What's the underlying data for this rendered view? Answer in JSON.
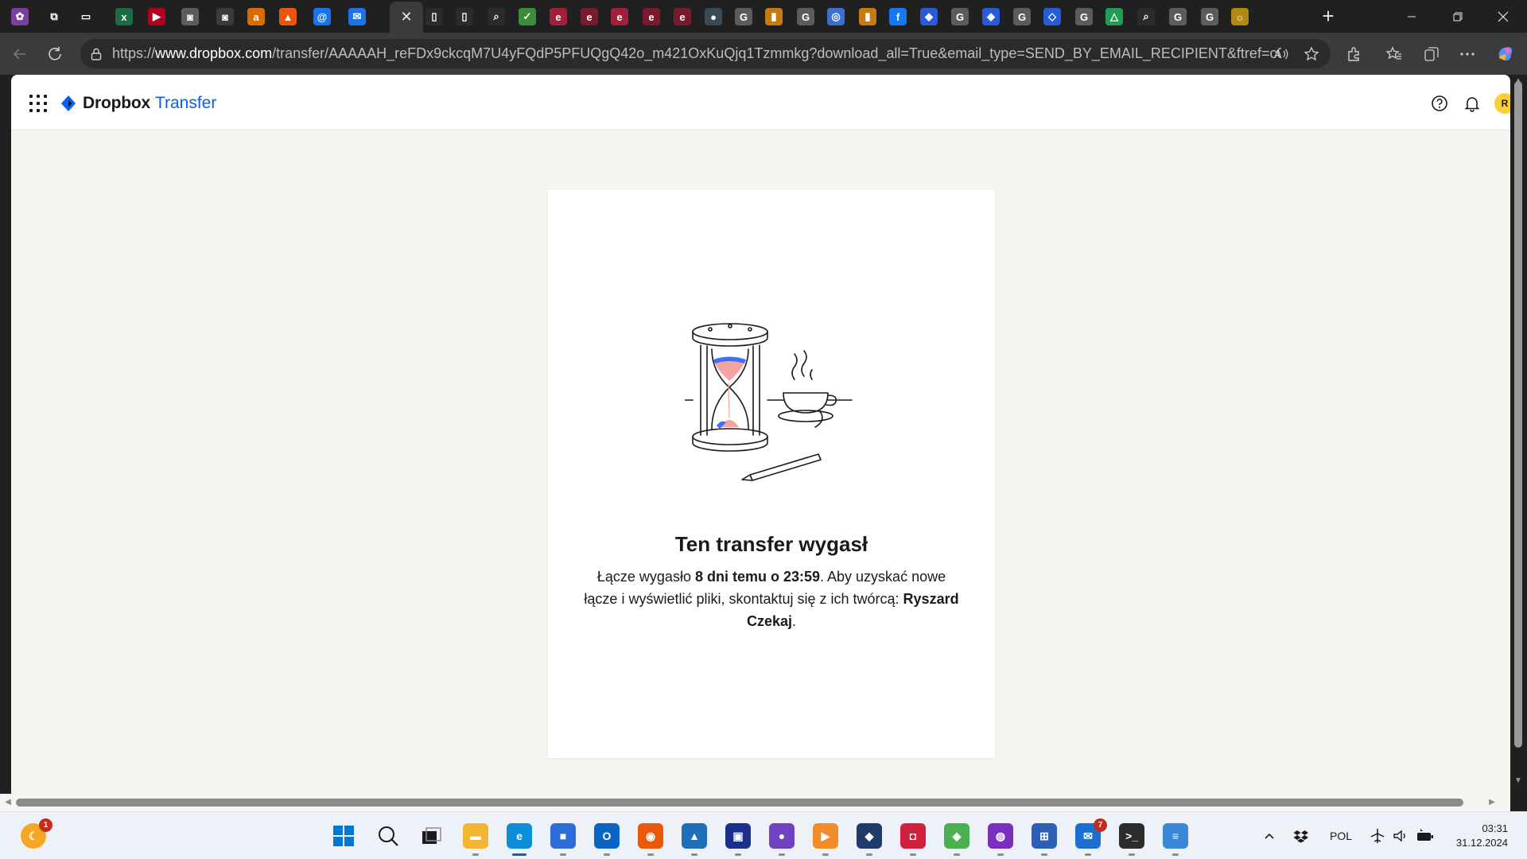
{
  "browser": {
    "url_prefix": "https://",
    "url_host": "www.dropbox.com",
    "url_path": "/transfer/AAAAAH_reFDx9ckcqM7U4yFQdP5PFUQgQ42o_m421OxKuQjq1Tzmmkg?download_all=True&email_type=SEND_BY_EMAIL_RECIPIENT&ftref=c0ee4fd...",
    "active_tab_close": "✕",
    "new_tab": "+",
    "tabs": [
      {
        "icon": "photo-app-icon",
        "glyph": "✿",
        "color": "#7a3fa0"
      },
      {
        "icon": "workspaces-icon",
        "glyph": "⧉",
        "color": "#202020"
      },
      {
        "icon": "tab-actions-icon",
        "glyph": "▭",
        "color": "#202020"
      },
      {
        "icon": "site-icon-x",
        "glyph": "x",
        "color": "#1d6b43"
      },
      {
        "icon": "youtube-icon",
        "glyph": "▶",
        "color": "#b00020"
      },
      {
        "icon": "camera-icon",
        "glyph": "◙",
        "color": "#5c5c5c"
      },
      {
        "icon": "camera-icon",
        "glyph": "◙",
        "color": "#3a3a3a"
      },
      {
        "icon": "amazon-icon",
        "glyph": "a",
        "color": "#d96b00"
      },
      {
        "icon": "allegro-icon",
        "glyph": "▲",
        "color": "#e8570d"
      },
      {
        "icon": "at-mail-icon",
        "glyph": "@",
        "color": "#1a73e8"
      },
      {
        "icon": "mail-icon",
        "glyph": "✉",
        "color": "#1a73e8"
      },
      {
        "icon": "document-icon",
        "glyph": "▯",
        "color": "#2b2b2b"
      },
      {
        "icon": "document-icon",
        "glyph": "▯",
        "color": "#2b2b2b"
      },
      {
        "icon": "search-icon",
        "glyph": "⌕",
        "color": "#2b2b2b"
      },
      {
        "icon": "check-icon",
        "glyph": "✓",
        "color": "#3b8c3b"
      },
      {
        "icon": "site-icon-e",
        "glyph": "e",
        "color": "#a0203a"
      },
      {
        "icon": "site-icon-e",
        "glyph": "e",
        "color": "#7a1a2c"
      },
      {
        "icon": "site-icon-e",
        "glyph": "e",
        "color": "#a0203a"
      },
      {
        "icon": "site-icon-e",
        "glyph": "e",
        "color": "#7a1a2c"
      },
      {
        "icon": "site-icon-e",
        "glyph": "e",
        "color": "#7a1a2c"
      },
      {
        "icon": "profile-icon",
        "glyph": "●",
        "color": "#3a4a55"
      },
      {
        "icon": "google-icon",
        "glyph": "G",
        "color": "#5c5c5c"
      },
      {
        "icon": "analytics-icon",
        "glyph": "▮",
        "color": "#c77a10"
      },
      {
        "icon": "google-icon",
        "glyph": "G",
        "color": "#5c5c5c"
      },
      {
        "icon": "chrome-icon",
        "glyph": "◎",
        "color": "#3d6fd1"
      },
      {
        "icon": "analytics-icon",
        "glyph": "▮",
        "color": "#c77a10"
      },
      {
        "icon": "facebook-icon",
        "glyph": "f",
        "color": "#1877f2"
      },
      {
        "icon": "tag-icon",
        "glyph": "◆",
        "color": "#2a5bd7"
      },
      {
        "icon": "google-icon",
        "glyph": "G",
        "color": "#5c5c5c"
      },
      {
        "icon": "tag-icon",
        "glyph": "◆",
        "color": "#2a5bd7"
      },
      {
        "icon": "google-icon",
        "glyph": "G",
        "color": "#5c5c5c"
      },
      {
        "icon": "tag-manager-icon",
        "glyph": "◇",
        "color": "#2a5bd7"
      },
      {
        "icon": "google-icon",
        "glyph": "G",
        "color": "#5c5c5c"
      },
      {
        "icon": "drive-icon",
        "glyph": "△",
        "color": "#1f9d55"
      },
      {
        "icon": "search-icon",
        "glyph": "⌕",
        "color": "#2b2b2b"
      },
      {
        "icon": "google-icon",
        "glyph": "G",
        "color": "#5c5c5c"
      },
      {
        "icon": "google-icon",
        "glyph": "G",
        "color": "#5c5c5c"
      },
      {
        "icon": "sun-icon",
        "glyph": "☼",
        "color": "#b08a10"
      }
    ]
  },
  "dropbox": {
    "brand": "Dropbox",
    "product": "Transfer",
    "avatar_initial": "R",
    "brand_blue": "#0061fe"
  },
  "card": {
    "title": "Ten transfer wygasł",
    "body_1": "Łącze wygasło ",
    "body_bold_1": "8 dni temu o 23:59",
    "body_2": ". Aby uzyskać nowe łącze i wyświetlić pliki, skontaktuj się z ich twórcą: ",
    "body_bold_2": "Ryszard Czekaj",
    "body_3": "."
  },
  "taskbar": {
    "weather_badge": "1",
    "mail_badge": "7",
    "language": "POL",
    "time": "03:31",
    "date": "31.12.2024",
    "accent": "#0067c0"
  }
}
